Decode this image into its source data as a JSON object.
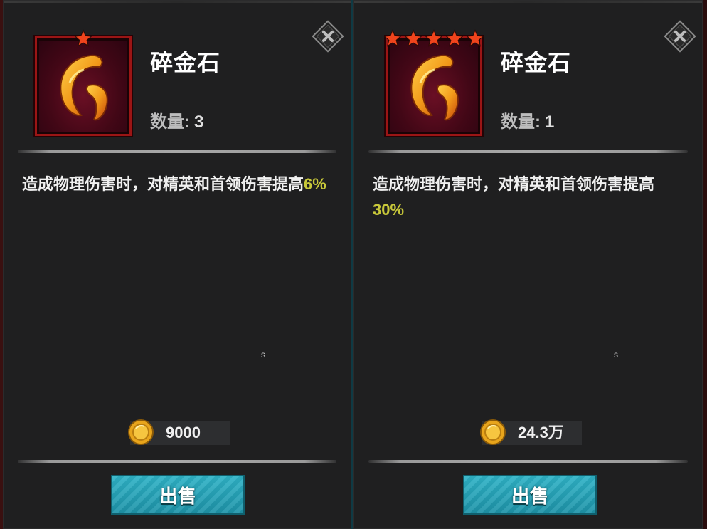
{
  "panels": [
    {
      "item_name": "碎金石",
      "quantity_label": "数量:",
      "quantity_value": "3",
      "stars": 1,
      "description_text": "造成物理伤害时，对精英和首领伤害提高",
      "description_value": "6%",
      "price": "9000",
      "marker": "s",
      "sell_label": "出售"
    },
    {
      "item_name": "碎金石",
      "quantity_label": "数量:",
      "quantity_value": "1",
      "stars": 5,
      "description_text": "造成物理伤害时，对精英和首领伤害提高",
      "description_value": "30%",
      "price": "24.3万",
      "marker": "s",
      "sell_label": "出售"
    }
  ],
  "icons": {
    "item": "gold-fragment-icon",
    "star": "star-icon",
    "close": "close-icon",
    "coin": "gold-coin-icon"
  },
  "colors": {
    "panel_bg": "#1f1f20",
    "frame_border": "#9b1515",
    "star": "#f0441c",
    "highlight": "#c8c83a",
    "sell_button": "#28a6bb"
  }
}
